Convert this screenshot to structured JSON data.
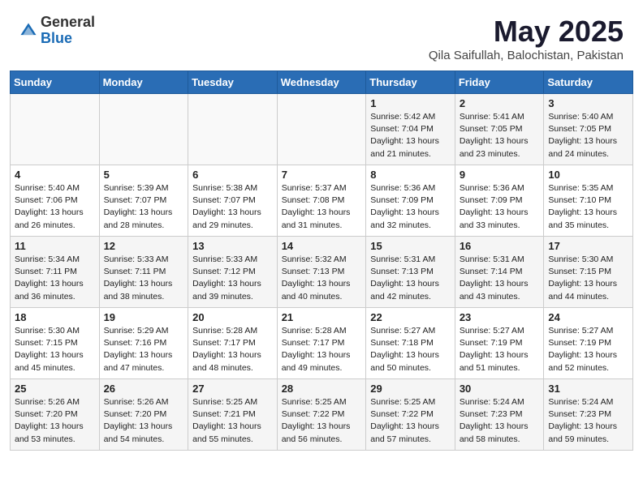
{
  "header": {
    "logo_general": "General",
    "logo_blue": "Blue",
    "month_title": "May 2025",
    "subtitle": "Qila Saifullah, Balochistan, Pakistan"
  },
  "weekdays": [
    "Sunday",
    "Monday",
    "Tuesday",
    "Wednesday",
    "Thursday",
    "Friday",
    "Saturday"
  ],
  "weeks": [
    [
      {
        "day": "",
        "info": ""
      },
      {
        "day": "",
        "info": ""
      },
      {
        "day": "",
        "info": ""
      },
      {
        "day": "",
        "info": ""
      },
      {
        "day": "1",
        "info": "Sunrise: 5:42 AM\nSunset: 7:04 PM\nDaylight: 13 hours\nand 21 minutes."
      },
      {
        "day": "2",
        "info": "Sunrise: 5:41 AM\nSunset: 7:05 PM\nDaylight: 13 hours\nand 23 minutes."
      },
      {
        "day": "3",
        "info": "Sunrise: 5:40 AM\nSunset: 7:05 PM\nDaylight: 13 hours\nand 24 minutes."
      }
    ],
    [
      {
        "day": "4",
        "info": "Sunrise: 5:40 AM\nSunset: 7:06 PM\nDaylight: 13 hours\nand 26 minutes."
      },
      {
        "day": "5",
        "info": "Sunrise: 5:39 AM\nSunset: 7:07 PM\nDaylight: 13 hours\nand 28 minutes."
      },
      {
        "day": "6",
        "info": "Sunrise: 5:38 AM\nSunset: 7:07 PM\nDaylight: 13 hours\nand 29 minutes."
      },
      {
        "day": "7",
        "info": "Sunrise: 5:37 AM\nSunset: 7:08 PM\nDaylight: 13 hours\nand 31 minutes."
      },
      {
        "day": "8",
        "info": "Sunrise: 5:36 AM\nSunset: 7:09 PM\nDaylight: 13 hours\nand 32 minutes."
      },
      {
        "day": "9",
        "info": "Sunrise: 5:36 AM\nSunset: 7:09 PM\nDaylight: 13 hours\nand 33 minutes."
      },
      {
        "day": "10",
        "info": "Sunrise: 5:35 AM\nSunset: 7:10 PM\nDaylight: 13 hours\nand 35 minutes."
      }
    ],
    [
      {
        "day": "11",
        "info": "Sunrise: 5:34 AM\nSunset: 7:11 PM\nDaylight: 13 hours\nand 36 minutes."
      },
      {
        "day": "12",
        "info": "Sunrise: 5:33 AM\nSunset: 7:11 PM\nDaylight: 13 hours\nand 38 minutes."
      },
      {
        "day": "13",
        "info": "Sunrise: 5:33 AM\nSunset: 7:12 PM\nDaylight: 13 hours\nand 39 minutes."
      },
      {
        "day": "14",
        "info": "Sunrise: 5:32 AM\nSunset: 7:13 PM\nDaylight: 13 hours\nand 40 minutes."
      },
      {
        "day": "15",
        "info": "Sunrise: 5:31 AM\nSunset: 7:13 PM\nDaylight: 13 hours\nand 42 minutes."
      },
      {
        "day": "16",
        "info": "Sunrise: 5:31 AM\nSunset: 7:14 PM\nDaylight: 13 hours\nand 43 minutes."
      },
      {
        "day": "17",
        "info": "Sunrise: 5:30 AM\nSunset: 7:15 PM\nDaylight: 13 hours\nand 44 minutes."
      }
    ],
    [
      {
        "day": "18",
        "info": "Sunrise: 5:30 AM\nSunset: 7:15 PM\nDaylight: 13 hours\nand 45 minutes."
      },
      {
        "day": "19",
        "info": "Sunrise: 5:29 AM\nSunset: 7:16 PM\nDaylight: 13 hours\nand 47 minutes."
      },
      {
        "day": "20",
        "info": "Sunrise: 5:28 AM\nSunset: 7:17 PM\nDaylight: 13 hours\nand 48 minutes."
      },
      {
        "day": "21",
        "info": "Sunrise: 5:28 AM\nSunset: 7:17 PM\nDaylight: 13 hours\nand 49 minutes."
      },
      {
        "day": "22",
        "info": "Sunrise: 5:27 AM\nSunset: 7:18 PM\nDaylight: 13 hours\nand 50 minutes."
      },
      {
        "day": "23",
        "info": "Sunrise: 5:27 AM\nSunset: 7:19 PM\nDaylight: 13 hours\nand 51 minutes."
      },
      {
        "day": "24",
        "info": "Sunrise: 5:27 AM\nSunset: 7:19 PM\nDaylight: 13 hours\nand 52 minutes."
      }
    ],
    [
      {
        "day": "25",
        "info": "Sunrise: 5:26 AM\nSunset: 7:20 PM\nDaylight: 13 hours\nand 53 minutes."
      },
      {
        "day": "26",
        "info": "Sunrise: 5:26 AM\nSunset: 7:20 PM\nDaylight: 13 hours\nand 54 minutes."
      },
      {
        "day": "27",
        "info": "Sunrise: 5:25 AM\nSunset: 7:21 PM\nDaylight: 13 hours\nand 55 minutes."
      },
      {
        "day": "28",
        "info": "Sunrise: 5:25 AM\nSunset: 7:22 PM\nDaylight: 13 hours\nand 56 minutes."
      },
      {
        "day": "29",
        "info": "Sunrise: 5:25 AM\nSunset: 7:22 PM\nDaylight: 13 hours\nand 57 minutes."
      },
      {
        "day": "30",
        "info": "Sunrise: 5:24 AM\nSunset: 7:23 PM\nDaylight: 13 hours\nand 58 minutes."
      },
      {
        "day": "31",
        "info": "Sunrise: 5:24 AM\nSunset: 7:23 PM\nDaylight: 13 hours\nand 59 minutes."
      }
    ]
  ]
}
